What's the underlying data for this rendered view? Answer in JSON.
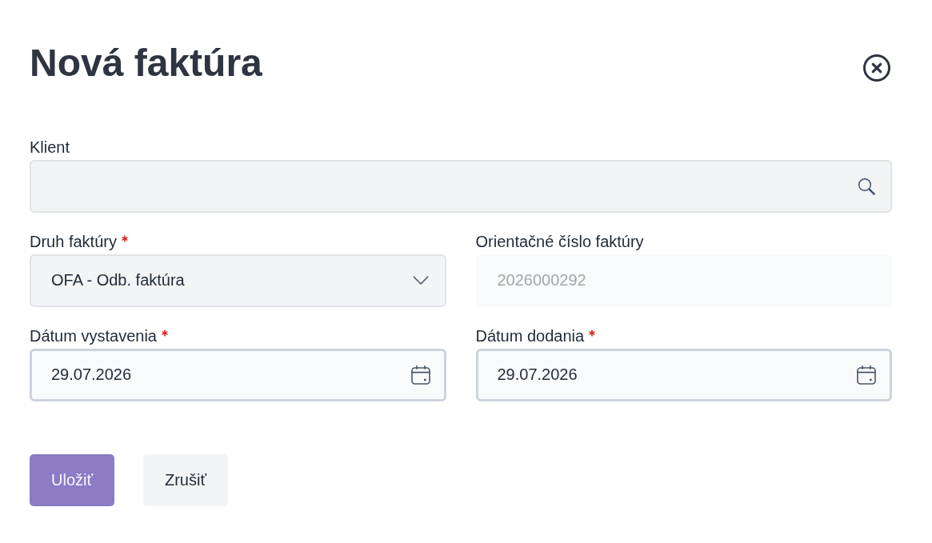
{
  "dialog": {
    "title": "Nová faktúra",
    "rows": [
      {
        "fields": [
          {
            "kind": "search",
            "label": "Klient",
            "required": false,
            "disabled": false
          }
        ]
      },
      {
        "fields": [
          {
            "kind": "select",
            "label": "Druh faktúry",
            "required": true,
            "disabled": false,
            "value": "OFA - Odb. faktúra"
          },
          {
            "kind": "text",
            "label": "Orientačné číslo faktúry",
            "required": false,
            "disabled": true,
            "value": "2026000292"
          }
        ]
      },
      {
        "fields": [
          {
            "kind": "date",
            "label": "Dátum vystavenia",
            "required": true,
            "disabled": false,
            "value": "29.07.2026"
          },
          {
            "kind": "date",
            "label": "Dátum dodania",
            "required": true,
            "disabled": false,
            "value": "29.07.2026"
          }
        ]
      }
    ],
    "buttons": [
      {
        "kind": "primary",
        "label": "Uložiť"
      },
      {
        "kind": "secondary",
        "label": "Zrušiť"
      }
    ]
  }
}
